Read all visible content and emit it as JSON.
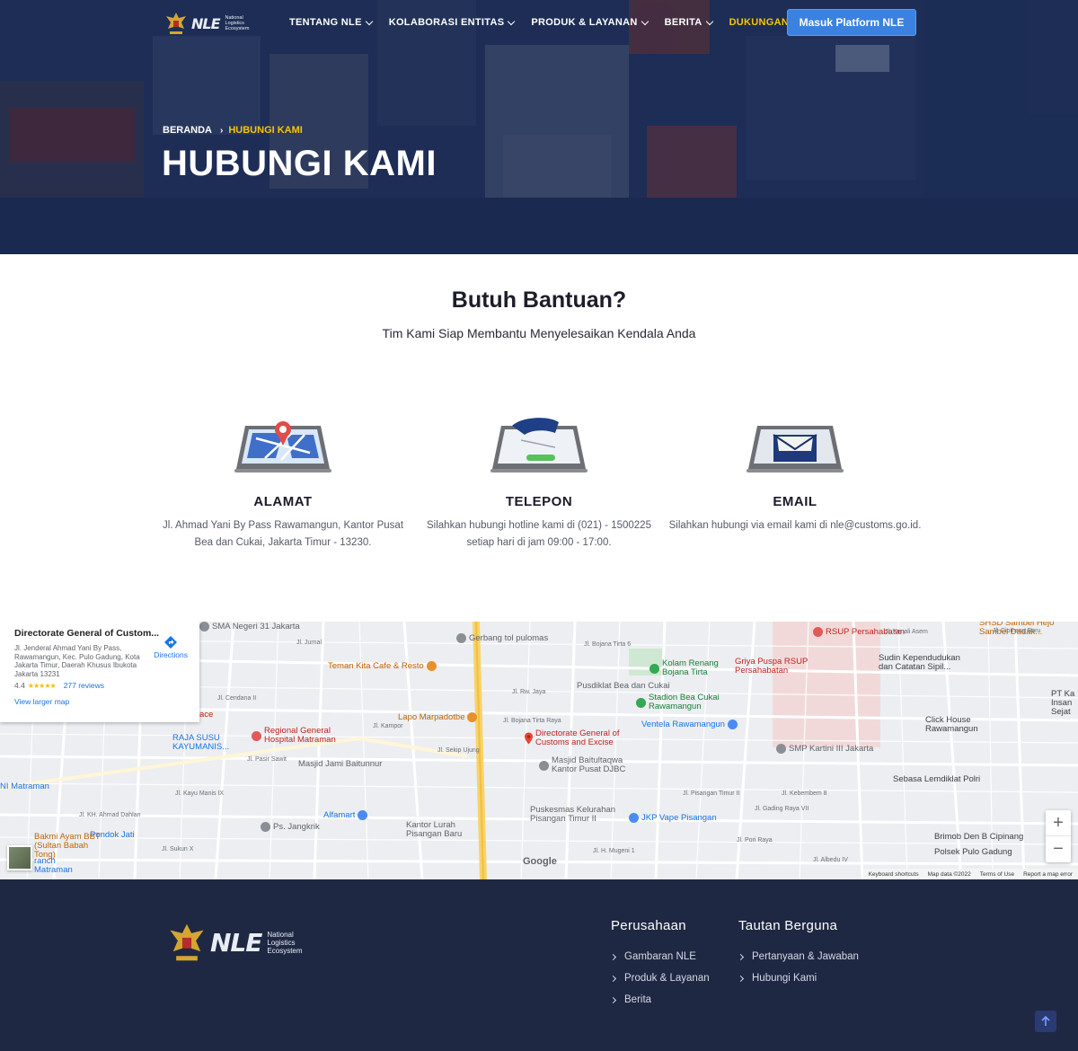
{
  "header": {
    "logo": {
      "mark": "NLE",
      "sub": [
        "National",
        "Logistics",
        "Ecosystem"
      ]
    },
    "menu": [
      {
        "label": "TENTANG NLE"
      },
      {
        "label": "KOLABORASI ENTITAS"
      },
      {
        "label": "PRODUK & LAYANAN"
      },
      {
        "label": "BERITA"
      },
      {
        "label": "DUKUNGAN",
        "active": true
      }
    ],
    "cta_label": "Masuk Platform NLE"
  },
  "hero": {
    "breadcrumb": {
      "home": "BERANDA",
      "current": "HUBUNGI KAMI"
    },
    "title": "HUBUNGI KAMI"
  },
  "help": {
    "title": "Butuh Bantuan?",
    "subtitle": "Tim Kami Siap Membantu Menyelesaikan Kendala Anda",
    "cards": [
      {
        "icon": "map-location-icon",
        "title": "ALAMAT",
        "desc": "Jl. Ahmad Yani By Pass Rawamangun, Kantor Pusat Bea dan Cukai, Jakarta Timur - 13230."
      },
      {
        "icon": "phone-call-icon",
        "title": "TELEPON",
        "desc": "Silahkan hubungi hotline kami di (021) - 1500225 setiap hari di jam 09:00 - 17:00."
      },
      {
        "icon": "email-envelope-icon",
        "title": "EMAIL",
        "desc": "Silahkan hubungi via email kami di nle@customs.go.id."
      }
    ]
  },
  "map": {
    "card": {
      "title": "Directorate General of Custom...",
      "address": "Jl. Jenderal Ahmad Yani By Pass, Rawamangun, Kec. Pulo Gadung, Kota Jakarta Timur, Daerah Khusus Ibukota Jakarta 13231",
      "rating": "4.4",
      "stars": "★★★★★",
      "reviews": "277 reviews",
      "larger_map": "View larger map",
      "directions": "Directions"
    },
    "pois": {
      "sma": "SMA Negeri 31 Jakarta",
      "gerbang": "Gerbang tol pulomas",
      "rsup": "RSUP Persahabatan",
      "sambel": "SHSD Sambel Hejo Sambel Dadak...",
      "teman": "Teman Kita Cafe & Resto",
      "kolam": "Kolam Renang Bojana Tirta",
      "griya": "Griya Puspa RSUP Persahabatan",
      "sudin": "Sudin Kependudukan dan Catatan Sipil...",
      "pusdiklat": "Pusdiklat Bea dan Cukai",
      "stadion": "Stadion Bea Cukai Rawamangun",
      "ptka": "PT Ka Insan Sejat",
      "lapo": "Lapo Marpadotbe",
      "ventela": "Ventela Rawamangun",
      "clickhouse": "Click House Rawamangun",
      "raja": "RAJA SUSU KAYUMANIS...",
      "regional": "Regional General Hospital Matraman",
      "dgc": "Directorate General of Customs and Excise",
      "smp": "SMP Kartini III Jakarta",
      "masjidjami": "Masjid Jami Baitunnur",
      "masjidbait": "Masjid Baitultaqwa Kantor Pusat DJBC",
      "sebasa": "Sebasa Lemdiklat Polri",
      "matraman": "NI Matraman",
      "alfamart": "Alfamart",
      "puskesmas": "Puskesmas Kelurahan Pisangan Timur II",
      "pondok": "Pondok Jati",
      "psjangkrik": "Ps. Jangkrik",
      "kantorlurah": "Kantor Lurah Pisangan Baru",
      "jkp": "JKP Vape Pisangan",
      "brimob": "Brimob Den B Cipinang",
      "bakmi": "Bakmi Ayam BBT (Sultan Babah Tong)",
      "branch": "ranch Matraman",
      "polsek": "Polsek Pulo Gadung",
      "ace": "ace"
    },
    "streets": {
      "rwjaya": "Jl. Rw. Jaya",
      "tirta6": "Jl. Bojana Tirta 6",
      "tirta": "Jl. Bojana Tirta Raya",
      "jurnal": "Jl. Jurnal",
      "cendana": "Jl. Cendana II",
      "kayumanis": "Jl. Kayu Manis IX",
      "ahmaddahlan": "Jl. KH. Ahmad Dahlan",
      "sukun": "Jl. Sukun X",
      "kebembem": "Jl. Kebembem 8",
      "pisangan": "Jl. Pisangan Timur II",
      "gading": "Jl. Gading Raya VII",
      "pori": "Jl. Pori Raya",
      "mugeni": "Jl. H. Mugeni 1",
      "cipinang": "Jl. Cipinang Baru",
      "kenali": "Jl. Kenali Asem",
      "albedu": "Jl. Albedu IV",
      "mutiara": "Jl. Sekip Ujung",
      "kampo": "Jl. Kampor",
      "pasir": "Jl. Pasir Sawit"
    },
    "google": "Google",
    "attribution": [
      "Keyboard shortcuts",
      "Map data ©2022",
      "Terms of Use",
      "Report a map error"
    ],
    "zoom_in": "+",
    "zoom_out": "−"
  },
  "footer": {
    "logo": {
      "mark": "NLE",
      "sub": [
        "National",
        "Logistics",
        "Ecosystem"
      ]
    },
    "col1": {
      "title": "Perusahaan",
      "links": [
        "Gambaran NLE",
        "Produk & Layanan",
        "Berita"
      ]
    },
    "col2": {
      "title": "Tautan Berguna",
      "links": [
        "Pertanyaan & Jawaban",
        "Hubungi Kami"
      ]
    }
  },
  "colors": {
    "accent": "#f7c600",
    "cta": "#3b82e0",
    "footer": "#1f2843",
    "hero_overlay": "#18264e"
  }
}
